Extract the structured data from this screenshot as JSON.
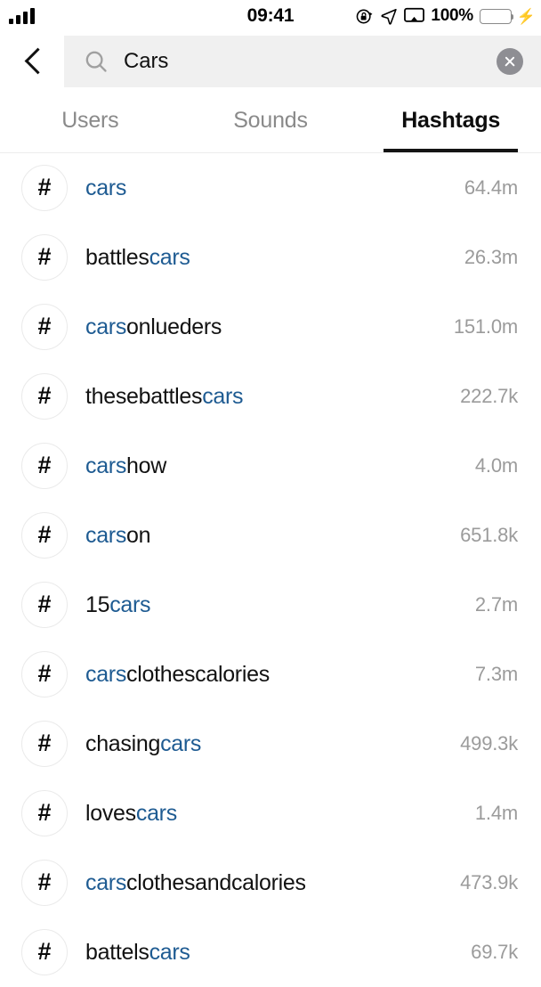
{
  "status_bar": {
    "signal_icon": "signal-bars-icon",
    "time": "09:41",
    "rotation_lock_icon": "rotation-lock-icon",
    "location_icon": "location-arrow-icon",
    "airplay_icon": "airplay-screen-icon",
    "battery_percent": "100%",
    "battery_icon": "battery-full-icon",
    "charging_icon": "lightning-bolt-icon",
    "battery_color": "#35d05a"
  },
  "search": {
    "back_icon": "back-chevron-icon",
    "search_icon": "search-icon",
    "value": "Cars",
    "placeholder": "Search",
    "clear_icon": "clear-circle-icon"
  },
  "tabs": {
    "items": [
      {
        "label": "Users",
        "active": false
      },
      {
        "label": "Sounds",
        "active": false
      },
      {
        "label": "Hashtags",
        "active": true
      }
    ],
    "active_color": "#141414",
    "inactive_color": "#8a8a8a"
  },
  "list": {
    "highlight_color": "#1e5b92",
    "hash_icon": "hashtag-icon",
    "query": "cars",
    "rows": [
      {
        "name": "cars",
        "parts": [
          {
            "t": "cars",
            "h": true
          }
        ],
        "count": "64.4m"
      },
      {
        "name": "battlescars",
        "parts": [
          {
            "t": "battles",
            "h": false
          },
          {
            "t": "cars",
            "h": true
          }
        ],
        "count": "26.3m"
      },
      {
        "name": "carsonlueders",
        "parts": [
          {
            "t": "cars",
            "h": true
          },
          {
            "t": "onlueders",
            "h": false
          }
        ],
        "count": "151.0m"
      },
      {
        "name": "thesebattlescars",
        "parts": [
          {
            "t": "thesebattles",
            "h": false
          },
          {
            "t": "cars",
            "h": true
          }
        ],
        "count": "222.7k"
      },
      {
        "name": "carshow",
        "parts": [
          {
            "t": "cars",
            "h": true
          },
          {
            "t": "how",
            "h": false
          }
        ],
        "count": "4.0m"
      },
      {
        "name": "carson",
        "parts": [
          {
            "t": "cars",
            "h": true
          },
          {
            "t": "on",
            "h": false
          }
        ],
        "count": "651.8k"
      },
      {
        "name": "15cars",
        "parts": [
          {
            "t": "15",
            "h": false
          },
          {
            "t": "cars",
            "h": true
          }
        ],
        "count": "2.7m"
      },
      {
        "name": "carsclothescalories",
        "parts": [
          {
            "t": "cars",
            "h": true
          },
          {
            "t": "clothescalories",
            "h": false
          }
        ],
        "count": "7.3m"
      },
      {
        "name": "chasingcars",
        "parts": [
          {
            "t": "chasing",
            "h": false
          },
          {
            "t": "cars",
            "h": true
          }
        ],
        "count": "499.3k"
      },
      {
        "name": "lovescars",
        "parts": [
          {
            "t": "loves",
            "h": false
          },
          {
            "t": "cars",
            "h": true
          }
        ],
        "count": "1.4m"
      },
      {
        "name": "carsclothesandcalories",
        "parts": [
          {
            "t": "cars",
            "h": true
          },
          {
            "t": "clothesandcalories",
            "h": false
          }
        ],
        "count": "473.9k"
      },
      {
        "name": "battelscars",
        "parts": [
          {
            "t": "battels",
            "h": false
          },
          {
            "t": "cars",
            "h": true
          }
        ],
        "count": "69.7k"
      }
    ]
  }
}
